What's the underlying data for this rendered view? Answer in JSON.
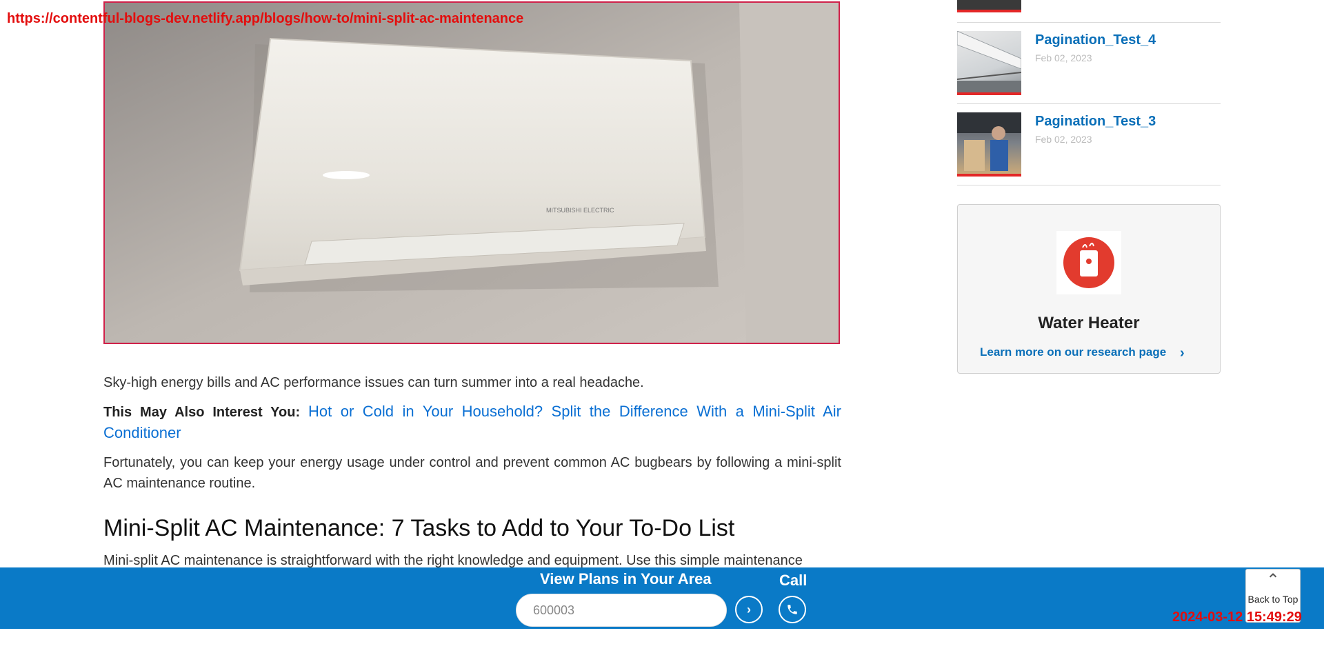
{
  "overlay": {
    "url": "https://contentful-blogs-dev.netlify.app/blogs/how-to/mini-split-ac-maintenance",
    "timestamp": "2024-03-12 15:49:29"
  },
  "hero": {
    "brand_text": "MITSUBISHI ELECTRIC"
  },
  "article": {
    "para1": "Sky-high energy bills and AC performance issues can turn summer into a real headache.",
    "interest_label": "This May Also Interest You:",
    "interest_link": "Hot or Cold in Your Household? Split the Difference With a Mini-Split Air Conditioner",
    "para2": "Fortunately, you can keep your energy usage under control and prevent common AC bugbears by following a mini-split AC maintenance routine.",
    "heading": "Mini-Split AC Maintenance: 7 Tasks to Add to Your To-Do List",
    "para3": "Mini-split AC maintenance is straightforward with the right knowledge and equipment. Use this simple maintenance"
  },
  "sidebar": {
    "items": [
      {
        "title": "Pagination_Test_4",
        "date": "Feb 02, 2023"
      },
      {
        "title": "Pagination_Test_3",
        "date": "Feb 02, 2023"
      }
    ]
  },
  "water_heater_card": {
    "title": "Water Heater",
    "link": "Learn more on our research page",
    "accent": "#e23b2e"
  },
  "bottom_bar": {
    "title": "View Plans in Your Area",
    "zip_value": "600003",
    "call_label": "Call",
    "background": "#0a7ac7"
  },
  "back_to_top": {
    "label": "Back to Top"
  }
}
